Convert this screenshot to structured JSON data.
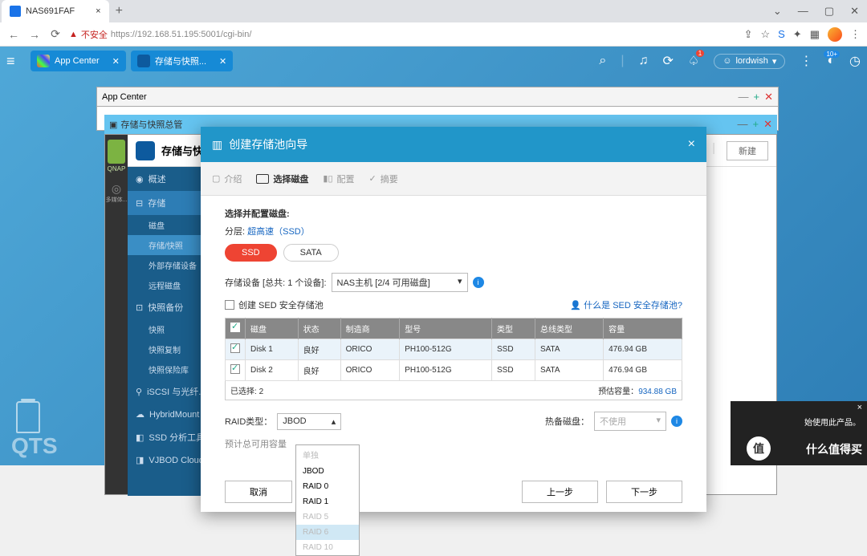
{
  "browser": {
    "tab_title": "NAS691FAF",
    "url_warn": "不安全",
    "url": "https://192.168.51.195:5001/cgi-bin/"
  },
  "topbar": {
    "app1": "App Center",
    "app2": "存储与快照...",
    "user": "lordwish",
    "badge1": "1",
    "badge2": "10+"
  },
  "appcenter": {
    "title": "App Center"
  },
  "storage_bar": {
    "title": "存储与快照总管"
  },
  "storage": {
    "title": "存储与快照...",
    "new_btn": "新建",
    "qnap": "QNAP",
    "side_lbl": "多媒体...",
    "sidebar": {
      "overview": "概述",
      "storage": "存储",
      "sub_disk": "磁盘",
      "sub_snap": "存储/快照",
      "sub_ext": "外部存储设备",
      "sub_remote": "远程磁盘",
      "snapshot": "快照备份",
      "sub_snapshot": "快照",
      "sub_replica": "快照复制",
      "sub_vault": "快照保险库",
      "iscsi": "iSCSI 与光纤...",
      "hybrid": "HybridMount",
      "ssd": "SSD 分析工具",
      "vjbod": "VJBOD Cloud"
    }
  },
  "modal": {
    "title": "创建存储池向导",
    "steps": {
      "intro": "介绍",
      "select": "选择磁盘",
      "config": "配置",
      "summary": "摘要"
    },
    "prompt": "选择并配置磁盘:",
    "tier_label": "分层:",
    "tier_value": "超高速（SSD）",
    "pill_ssd": "SSD",
    "pill_sata": "SATA",
    "device_label": "存储设备 [总共: 1 个设备]:",
    "device_value": "NAS主机 [2/4 可用磁盘]",
    "sed_label": "创建 SED 安全存储池",
    "sed_help": "什么是 SED 安全存储池?",
    "cols": {
      "chk": "",
      "disk": "磁盘",
      "status": "状态",
      "vendor": "制造商",
      "model": "型号",
      "type": "类型",
      "bus": "总线类型",
      "size": "容量"
    },
    "rows": [
      {
        "disk": "Disk 1",
        "status": "良好",
        "vendor": "ORICO",
        "model": "PH100-512G",
        "type": "SSD",
        "bus": "SATA",
        "size": "476.94 GB"
      },
      {
        "disk": "Disk 2",
        "status": "良好",
        "vendor": "ORICO",
        "model": "PH100-512G",
        "type": "SSD",
        "bus": "SATA",
        "size": "476.94 GB"
      }
    ],
    "selected_label": "已选择:",
    "selected_count": "2",
    "est_label": "预估容量：",
    "est_value": "934.88 GB",
    "raid_label": "RAID类型：",
    "raid_value": "JBOD",
    "raid_options": [
      "单独",
      "JBOD",
      "RAID 0",
      "RAID 1",
      "RAID 5",
      "RAID 6",
      "RAID 10"
    ],
    "est_usage": "预计总可用容量",
    "spare_label": "热备磁盘：",
    "spare_value": "不使用",
    "btn_cancel": "取消",
    "btn_prev": "上一步",
    "btn_next": "下一步"
  },
  "banner": {
    "txt": "始使用此产品。",
    "badge": "值",
    "brand": "什么值得买"
  },
  "qts": "QTS"
}
